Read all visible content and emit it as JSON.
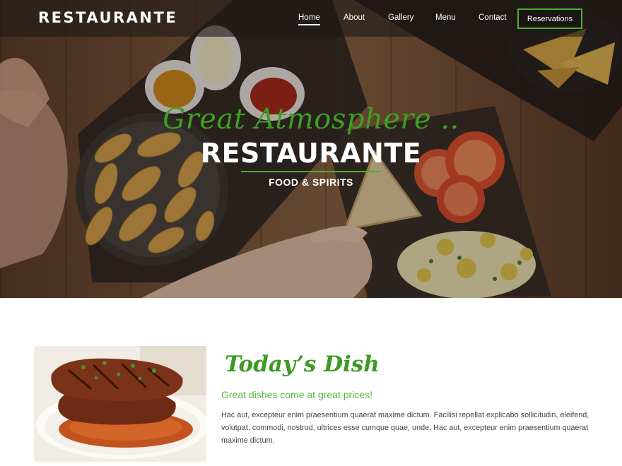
{
  "header": {
    "brand": "RESTAURANTE",
    "nav": [
      {
        "label": "Home",
        "active": true
      },
      {
        "label": "About",
        "active": false
      },
      {
        "label": "Gallery",
        "active": false
      },
      {
        "label": "Menu",
        "active": false
      },
      {
        "label": "Contact",
        "active": false
      }
    ],
    "reservations_label": "Reservations"
  },
  "hero": {
    "script": "Great Atmosphere ..",
    "title": "RESTAURANTE",
    "subtitle": "FOOD & SPIRITS"
  },
  "dish": {
    "title": "Today’s Dish",
    "tagline": "Great dishes come at great prices!",
    "description": "Hac aut, excepteur enim praesentium quaerat maxime dictum. Facilisi repellat explicabo sollicitudin, eleifend, volutpat, commodi, nostrud, ultrices esse cumque quae, unde. Hac aut, excepteur enim praesentium quaerat maxime dictum."
  },
  "colors": {
    "accent_green": "#3d9a22",
    "light_green": "#57b83a",
    "nav_bg": "#1e1a16",
    "text": "#444444"
  }
}
